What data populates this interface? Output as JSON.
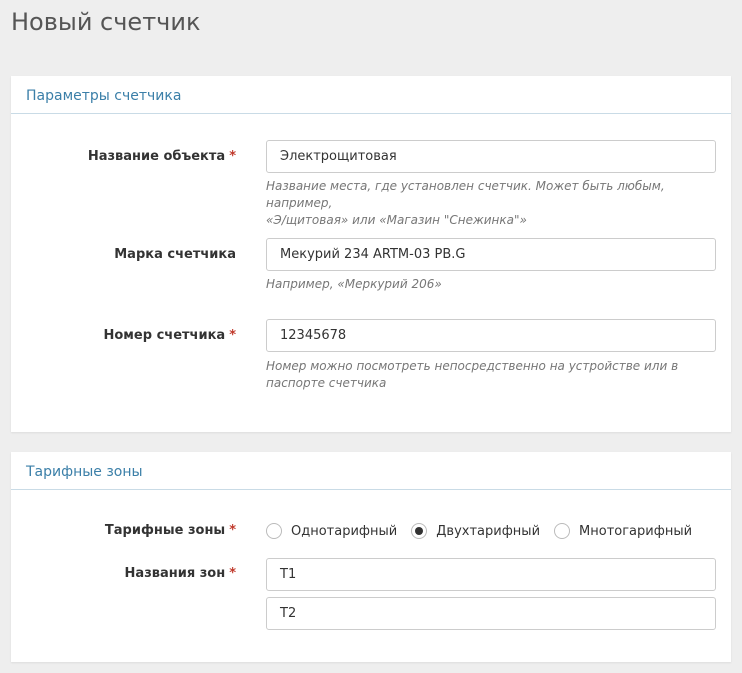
{
  "page": {
    "title": "Новый счетчик"
  },
  "params_panel": {
    "heading": "Параметры счетчика",
    "object_name": {
      "label": "Название объекта",
      "required_mark": "*",
      "value": "Электрощитовая",
      "help_line1": "Название места, где установлен счетчик. Может быть любым, например,",
      "help_line2": "«Э/щитовая» или «Магазин \"Снежинка\"»"
    },
    "meter_brand": {
      "label": "Марка счетчика",
      "value": "Мекурий 234 ARTM-03 PB.G",
      "help": "Например, «Меркурий 206»"
    },
    "meter_number": {
      "label": "Номер счетчика",
      "required_mark": "*",
      "value": "12345678",
      "help_line1": "Номер можно посмотреть непосредственно на устройстве или в",
      "help_line2": "паспорте счетчика"
    }
  },
  "tariff_panel": {
    "heading": "Тарифные зоны",
    "zones": {
      "label": "Тарифные зоны",
      "required_mark": "*",
      "options": [
        {
          "label": "Однотарифный",
          "checked": false
        },
        {
          "label": "Двухтарифный",
          "checked": true
        },
        {
          "label": "Мнотогарифный",
          "checked": false
        }
      ]
    },
    "zone_names": {
      "label": "Названия зон",
      "required_mark": "*",
      "values": [
        "T1",
        "T2"
      ]
    }
  }
}
